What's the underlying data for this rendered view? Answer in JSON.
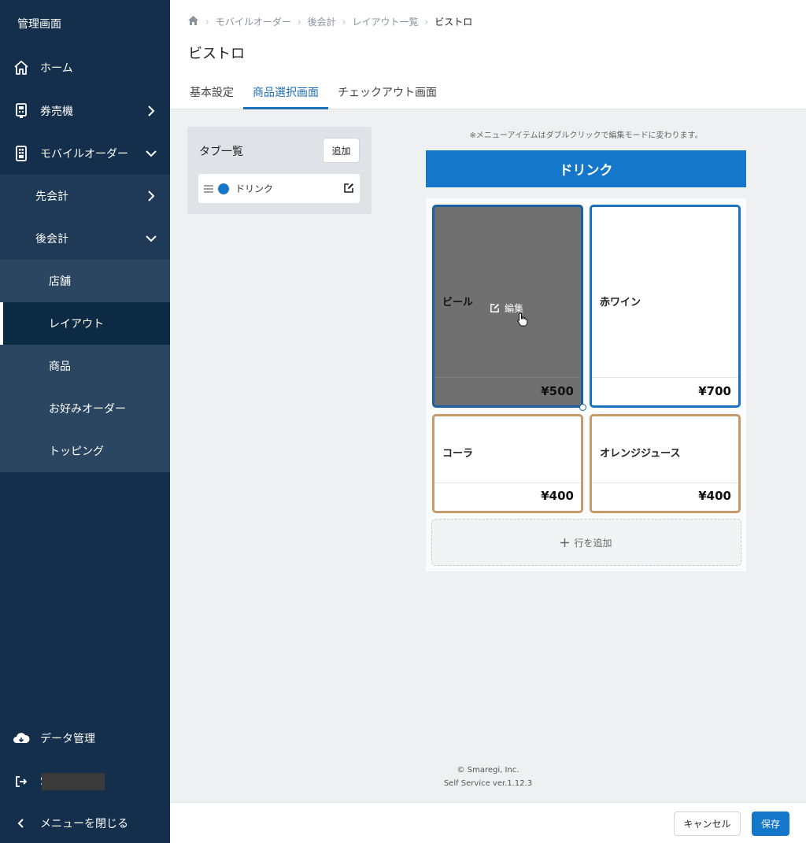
{
  "sidebar": {
    "title": "管理画面",
    "items": [
      {
        "label": "ホーム",
        "icon": "home-icon"
      },
      {
        "label": "券売機",
        "icon": "ticket-machine-icon"
      },
      {
        "label": "モバイルオーダー",
        "icon": "mobile-icon"
      },
      {
        "label": "先会計"
      },
      {
        "label": "後会計"
      },
      {
        "label": "店舗"
      },
      {
        "label": "レイアウト"
      },
      {
        "label": "商品"
      },
      {
        "label": "お好みオーダー"
      },
      {
        "label": "トッピング"
      }
    ],
    "data_mgmt": "データ管理",
    "user_initial": "S",
    "close_menu": "メニューを閉じる"
  },
  "breadcrumb": [
    "モバイルオーダー",
    "後会計",
    "レイアウト一覧",
    "ビストロ"
  ],
  "page_title": "ビストロ",
  "tabs": [
    "基本設定",
    "商品選択画面",
    "チェックアウト画面"
  ],
  "tab_list": {
    "title": "タブ一覧",
    "add_label": "追加",
    "items": [
      {
        "label": "ドリンク",
        "color": "#1577c9"
      }
    ]
  },
  "preview": {
    "note": "※メニューアイテムはダブルクリックで編集モードに変わります。",
    "tab_name": "ドリンク",
    "edit_label": "編集",
    "items": [
      {
        "name": "ビール",
        "price": "¥500"
      },
      {
        "name": "赤ワイン",
        "price": "¥700"
      },
      {
        "name": "コーラ",
        "price": "¥400"
      },
      {
        "name": "オレンジジュース",
        "price": "¥400"
      }
    ],
    "add_row": "行を追加"
  },
  "credits": {
    "line1": "© Smaregi, Inc.",
    "line2": "Self Service ver.1.12.3"
  },
  "footer": {
    "cancel": "キャンセル",
    "save": "保存"
  },
  "colors": {
    "sidebar": "#132f4c",
    "accent": "#1577c9",
    "card_blue_border": "#1a72c1",
    "card_tan_border": "#c79a6c"
  }
}
